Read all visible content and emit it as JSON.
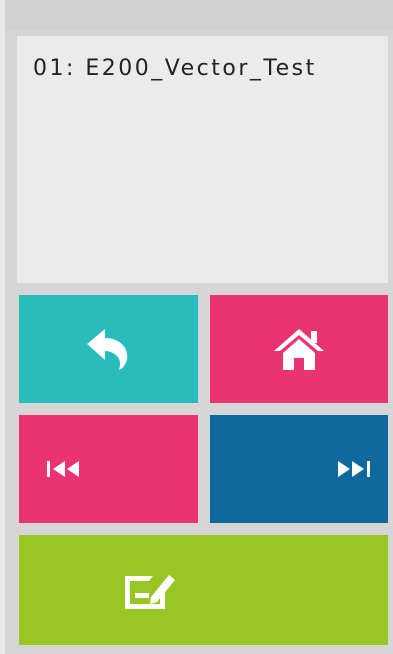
{
  "display": {
    "text": "01: E200_Vector_Test"
  },
  "buttons": {
    "back": {
      "icon": "back-arrow-icon",
      "color": "#28bcbc"
    },
    "home": {
      "icon": "home-icon",
      "color": "#ea3370"
    },
    "prev": {
      "icon": "skip-previous-icon",
      "color": "#ea3370"
    },
    "next": {
      "icon": "skip-next-icon",
      "color": "#10699e"
    },
    "edit": {
      "icon": "edit-icon",
      "color": "#98c623"
    }
  },
  "colors": {
    "background": "#d6d6d6",
    "display_bg": "#ebebeb",
    "icon": "#ffffff"
  }
}
